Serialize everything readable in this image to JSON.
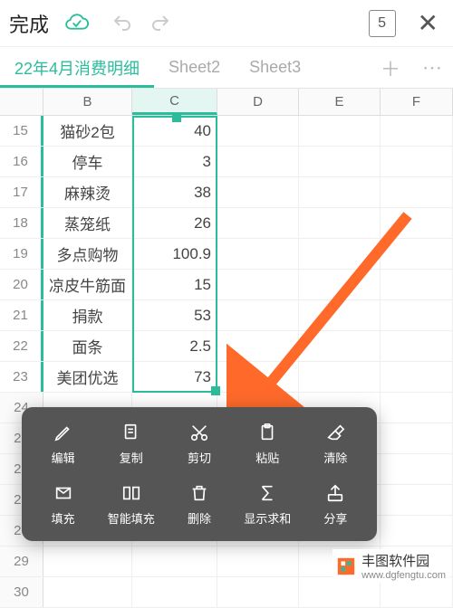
{
  "toolbar": {
    "done_label": "完成",
    "page_badge": "5"
  },
  "tabs": {
    "active": "22年4月消费明细",
    "sheet2": "Sheet2",
    "sheet3": "Sheet3"
  },
  "columns": [
    "B",
    "C",
    "D",
    "E",
    "F"
  ],
  "rows": [
    {
      "n": 15,
      "b": "猫砂2包",
      "c": "40"
    },
    {
      "n": 16,
      "b": "停车",
      "c": "3"
    },
    {
      "n": 17,
      "b": "麻辣烫",
      "c": "38"
    },
    {
      "n": 18,
      "b": "蒸笼纸",
      "c": "26"
    },
    {
      "n": 19,
      "b": "多点购物",
      "c": "100.9"
    },
    {
      "n": 20,
      "b": "凉皮牛筋面",
      "c": "15"
    },
    {
      "n": 21,
      "b": "捐款",
      "c": "53"
    },
    {
      "n": 22,
      "b": "面条",
      "c": "2.5"
    },
    {
      "n": 23,
      "b": "美团优选",
      "c": "73"
    },
    {
      "n": 24,
      "b": "",
      "c": ""
    },
    {
      "n": 25,
      "b": "",
      "c": ""
    },
    {
      "n": 26,
      "b": "",
      "c": ""
    },
    {
      "n": 27,
      "b": "",
      "c": ""
    },
    {
      "n": 28,
      "b": "",
      "c": ""
    },
    {
      "n": 29,
      "b": "",
      "c": ""
    },
    {
      "n": 30,
      "b": "",
      "c": ""
    }
  ],
  "context_menu": {
    "edit": "编辑",
    "copy": "复制",
    "cut": "剪切",
    "paste": "粘贴",
    "clear": "清除",
    "fill": "填充",
    "smart_fill": "智能填充",
    "delete": "删除",
    "sum": "显示求和",
    "share": "分享"
  },
  "watermark": {
    "brand": "丰图软件园",
    "url": "www.dgfengtu.com"
  },
  "colors": {
    "accent": "#2bbd9b",
    "arrow": "#ff6a2b",
    "menu_bg": "#555"
  }
}
